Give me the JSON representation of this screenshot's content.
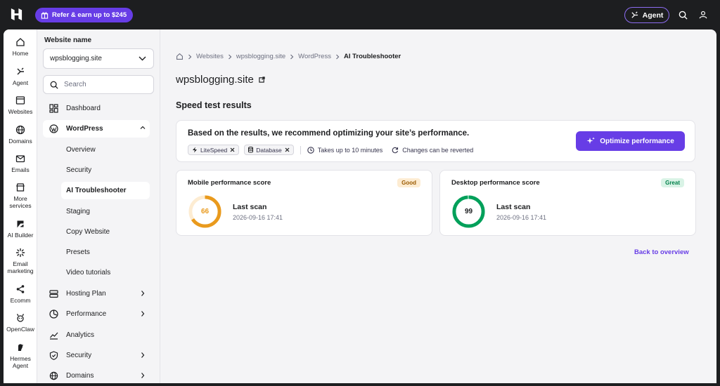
{
  "topbar": {
    "refer_label": "Refer & earn up to $245",
    "agent_label": "Agent"
  },
  "rail": [
    {
      "label": "Home",
      "icon": "home-icon"
    },
    {
      "label": "Agent",
      "icon": "agent-icon"
    },
    {
      "label": "Websites",
      "icon": "websites-icon"
    },
    {
      "label": "Domains",
      "icon": "globe-icon"
    },
    {
      "label": "Emails",
      "icon": "mail-icon"
    },
    {
      "label": "More services",
      "icon": "store-icon"
    },
    {
      "label": "AI Builder",
      "icon": "ai-builder-icon"
    },
    {
      "label": "Email marketing",
      "icon": "email-marketing-icon"
    },
    {
      "label": "Ecomm",
      "icon": "share-icon"
    },
    {
      "label": "OpenClaw",
      "icon": "openclaw-icon"
    },
    {
      "label": "Hermes Agent",
      "icon": "hermes-icon"
    }
  ],
  "sidenav": {
    "website_label": "Website name",
    "selected_site": "wpsblogging.site",
    "search_placeholder": "Search",
    "items": [
      {
        "label": "Dashboard"
      },
      {
        "label": "WordPress"
      },
      {
        "label": "Hosting Plan"
      },
      {
        "label": "Performance"
      },
      {
        "label": "Analytics"
      },
      {
        "label": "Security"
      },
      {
        "label": "Domains"
      }
    ],
    "wordpress_sub": [
      {
        "label": "Overview"
      },
      {
        "label": "Security"
      },
      {
        "label": "AI Troubleshooter"
      },
      {
        "label": "Staging"
      },
      {
        "label": "Copy Website"
      },
      {
        "label": "Presets"
      },
      {
        "label": "Video tutorials"
      }
    ]
  },
  "breadcrumb": [
    "Websites",
    "wpsblogging.site",
    "WordPress",
    "AI Troubleshooter"
  ],
  "page_title": "wpsblogging.site",
  "section_title": "Speed test results",
  "recommendation": {
    "text": "Based on the results, we recommend optimizing your site’s performance.",
    "chips": [
      "LiteSpeed",
      "Database"
    ],
    "time_note": "Takes up to 10 minutes",
    "revert_note": "Changes can be reverted",
    "button_label": "Optimize performance"
  },
  "scores": [
    {
      "title": "Mobile performance score",
      "badge": "Good",
      "score": "66",
      "scan_label": "Last scan",
      "date": "2026-09-16 17:41",
      "color": "#e99a1d",
      "track": "#fdecd2"
    },
    {
      "title": "Desktop performance score",
      "badge": "Great",
      "score": "99",
      "scan_label": "Last scan",
      "date": "2026-09-16 17:41",
      "color": "#00a05a",
      "track": "#d9f3e6"
    }
  ],
  "back_label": "Back to overview"
}
